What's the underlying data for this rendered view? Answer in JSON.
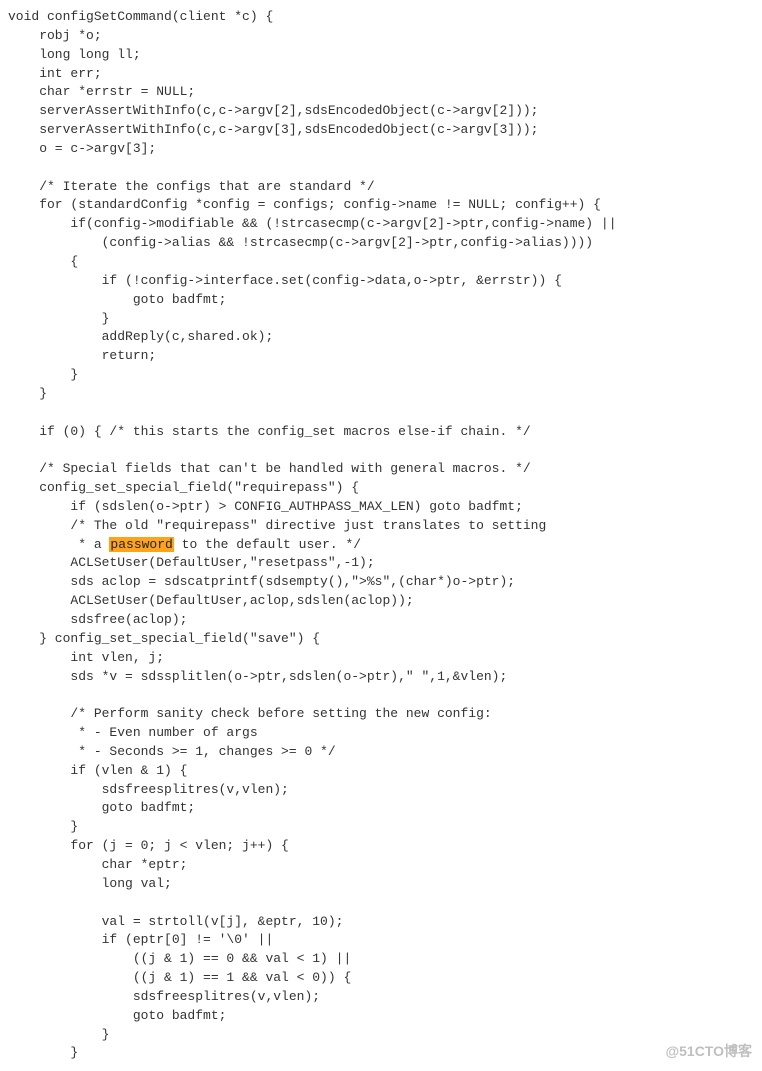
{
  "code_lines": [
    "void configSetCommand(client *c) {",
    "    robj *o;",
    "    long long ll;",
    "    int err;",
    "    char *errstr = NULL;",
    "    serverAssertWithInfo(c,c->argv[2],sdsEncodedObject(c->argv[2]));",
    "    serverAssertWithInfo(c,c->argv[3],sdsEncodedObject(c->argv[3]));",
    "    o = c->argv[3];",
    "",
    "    /* Iterate the configs that are standard */",
    "    for (standardConfig *config = configs; config->name != NULL; config++) {",
    "        if(config->modifiable && (!strcasecmp(c->argv[2]->ptr,config->name) ||",
    "            (config->alias && !strcasecmp(c->argv[2]->ptr,config->alias))))",
    "        {",
    "            if (!config->interface.set(config->data,o->ptr, &errstr)) {",
    "                goto badfmt;",
    "            }",
    "            addReply(c,shared.ok);",
    "            return;",
    "        }",
    "    }",
    "",
    "    if (0) { /* this starts the config_set macros else-if chain. */",
    "",
    "    /* Special fields that can't be handled with general macros. */",
    "    config_set_special_field(\"requirepass\") {",
    "        if (sdslen(o->ptr) > CONFIG_AUTHPASS_MAX_LEN) goto badfmt;",
    "        /* The old \"requirepass\" directive just translates to setting",
    "         * a password to the default user. */",
    "        ACLSetUser(DefaultUser,\"resetpass\",-1);",
    "        sds aclop = sdscatprintf(sdsempty(),\">%s\",(char*)o->ptr);",
    "        ACLSetUser(DefaultUser,aclop,sdslen(aclop));",
    "        sdsfree(aclop);",
    "    } config_set_special_field(\"save\") {",
    "        int vlen, j;",
    "        sds *v = sdssplitlen(o->ptr,sdslen(o->ptr),\" \",1,&vlen);",
    "",
    "        /* Perform sanity check before setting the new config:",
    "         * - Even number of args",
    "         * - Seconds >= 1, changes >= 0 */",
    "        if (vlen & 1) {",
    "            sdsfreesplitres(v,vlen);",
    "            goto badfmt;",
    "        }",
    "        for (j = 0; j < vlen; j++) {",
    "            char *eptr;",
    "            long val;",
    "",
    "            val = strtoll(v[j], &eptr, 10);",
    "            if (eptr[0] != '\\0' ||",
    "                ((j & 1) == 0 && val < 1) ||",
    "                ((j & 1) == 1 && val < 0)) {",
    "                sdsfreesplitres(v,vlen);",
    "                goto badfmt;",
    "            }",
    "        }"
  ],
  "highlight_word": "password",
  "highlight_line_index": 28,
  "watermark_text": "@51CTO博客"
}
